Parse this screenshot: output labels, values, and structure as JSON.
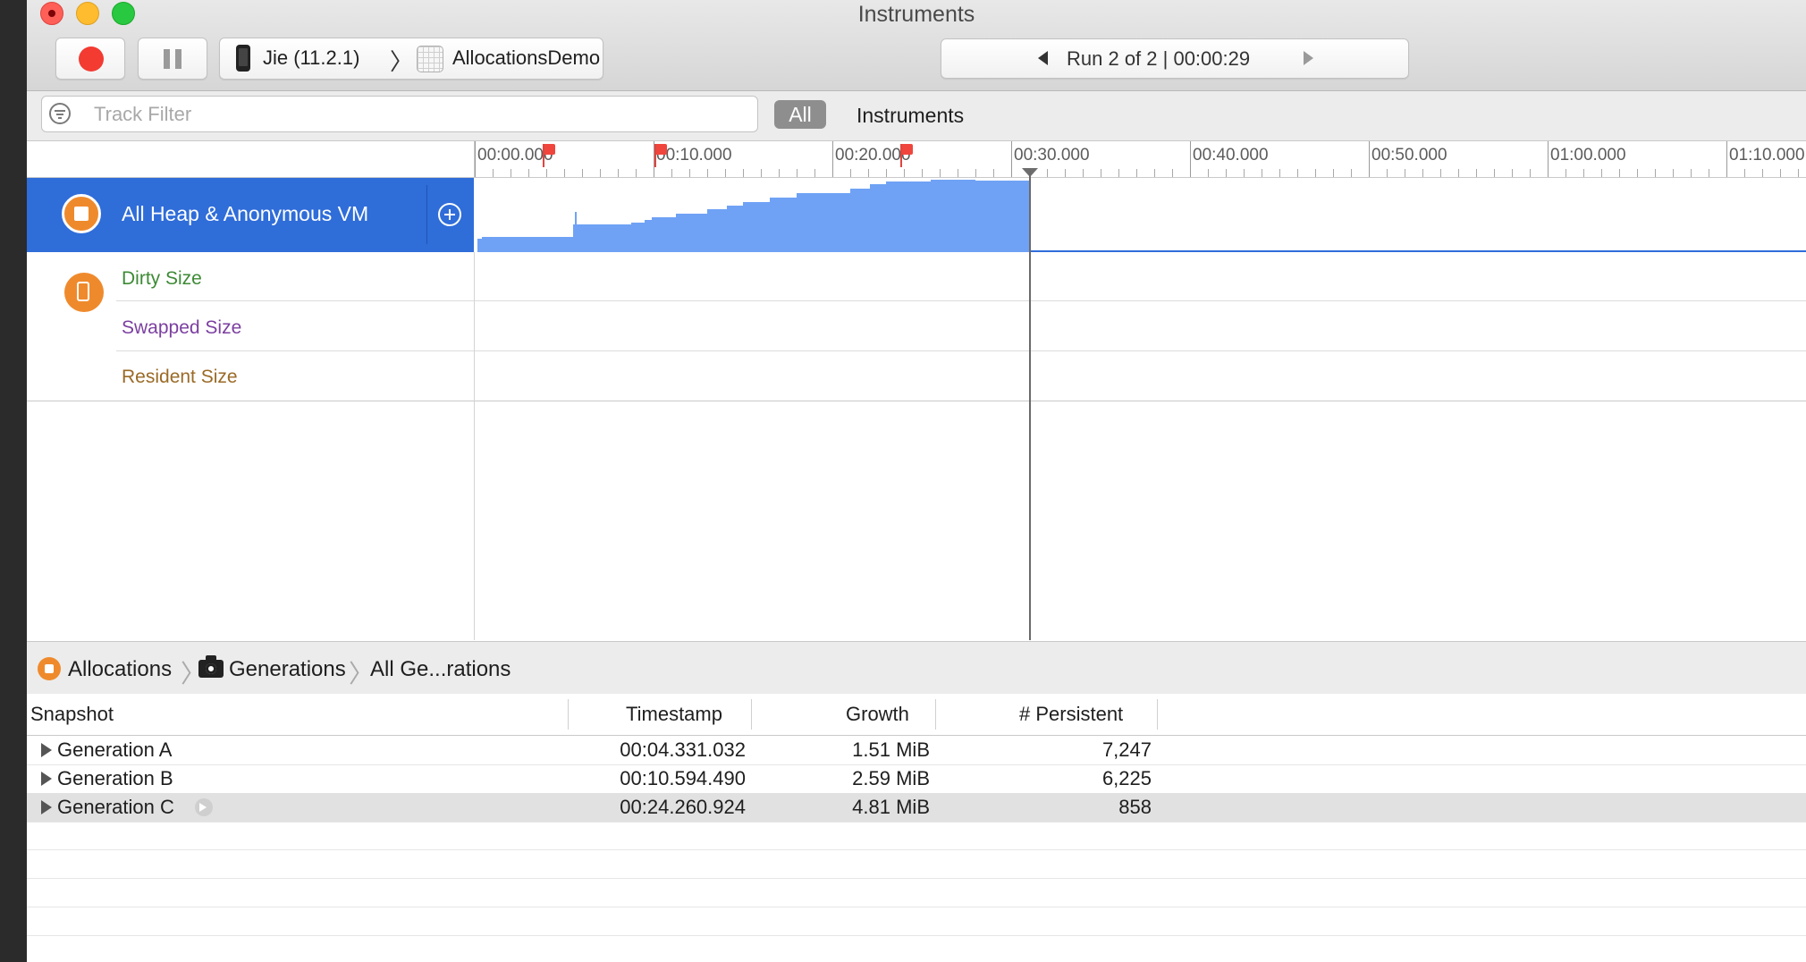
{
  "window": {
    "title": "Instruments"
  },
  "toolbar": {
    "target_device": "Jie (11.2.1)",
    "target_app": "AllocationsDemo",
    "run_label": "Run 2 of 2  |  00:00:29"
  },
  "filter": {
    "placeholder": "Track Filter",
    "value": "",
    "scope_all": "All",
    "scope_instruments": "Instruments"
  },
  "timeline": {
    "ruler_labels": [
      "00:00.000",
      "00:10.000",
      "00:20.000",
      "00:30.000",
      "00:40.000",
      "00:50.000",
      "01:00.000",
      "01:10.000"
    ],
    "track": {
      "name": "All Heap & Anonymous VM",
      "fill_color": "#6fa2f5",
      "selected_color": "#2f6dd9"
    },
    "sub_tracks": [
      "Dirty Size",
      "Swapped Size",
      "Resident Size"
    ]
  },
  "detail": {
    "breadcrumbs": [
      "Allocations",
      "Generations",
      "All Ge...rations"
    ],
    "columns": [
      "Snapshot",
      "Timestamp",
      "Growth",
      "# Persistent"
    ],
    "rows": [
      {
        "snapshot": "Generation A",
        "timestamp": "00:04.331.032",
        "growth": "1.51 MiB",
        "persistent": "7,247"
      },
      {
        "snapshot": "Generation B",
        "timestamp": "00:10.594.490",
        "growth": "2.59 MiB",
        "persistent": "6,225"
      },
      {
        "snapshot": "Generation C",
        "timestamp": "00:24.260.924",
        "growth": "4.81 MiB",
        "persistent": "858"
      }
    ]
  },
  "icons": {
    "close": "close-button-icon",
    "minimize": "minimize-button-icon",
    "zoom": "zoom-button-icon",
    "record": "record-icon",
    "pause": "pause-icon",
    "device": "iphone-icon",
    "app": "app-icon",
    "filter": "filter-icon",
    "track": "allocations-icon",
    "vm": "vm-tracker-icon",
    "add": "add-circle-icon",
    "camera": "camera-icon"
  }
}
